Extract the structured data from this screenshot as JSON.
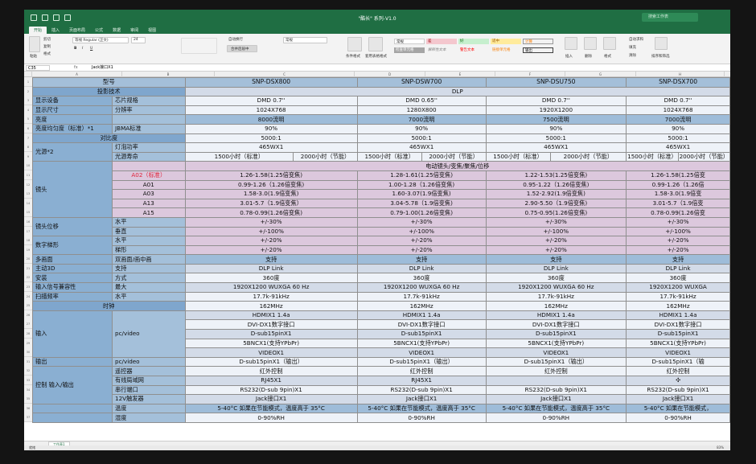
{
  "window": {
    "title": "\"酷长\" 系列-V1.0",
    "search_placeholder": "搜索工作表"
  },
  "ribbon_tabs": [
    "开始",
    "插入",
    "页面布局",
    "公式",
    "数据",
    "审阅",
    "视图"
  ],
  "ribbon": {
    "paste": "粘贴",
    "cut": "剪切",
    "copy": "复制",
    "format_painter": "格式",
    "font_name": "等线 Regular (正文)",
    "font_size": "24",
    "wrap_text": "自动换行",
    "merge_center": "合并后居中",
    "number_format": "常规",
    "conditional_format": "条件格式",
    "format_as_table": "套用表格格式",
    "styles": {
      "normal": "常规",
      "bad": "差",
      "good": "好",
      "neutral": "适中",
      "calculation": "计算",
      "check_cell": "检查单元格",
      "explanatory": "解释性文本",
      "warning": "警告文本",
      "linked": "链接单元格",
      "output": "输出"
    },
    "insert": "插入",
    "delete": "删除",
    "format": "格式",
    "autosum": "自动求和",
    "fill": "填充",
    "clear": "清除",
    "sort_filter": "排序和筛选"
  },
  "formula_bar": {
    "name_box": "C35",
    "fx": "fx",
    "value": "Jack接口X1"
  },
  "columns": [
    "A",
    "B",
    "C",
    "D",
    "E",
    "F",
    "G",
    "H",
    "I"
  ],
  "sheet_tab": "工作表1",
  "status": {
    "ready": "就绪",
    "zoom": "83%"
  },
  "table": {
    "header": {
      "label": "型号",
      "models": [
        "SNP-DSX800",
        "SNP-DSW700",
        "SNP-DSU750",
        "SNP-DSX700"
      ]
    },
    "projection_tech": {
      "label": "投影技术",
      "value": "DLP"
    },
    "rows_a": [
      {
        "a": "显示设备",
        "b": "芯片规格",
        "v": [
          "DMD 0.7''",
          "DMD 0.65''",
          "DMD 0.7''",
          "DMD 0.7''"
        ]
      },
      {
        "a": "显示尺寸",
        "b": "分辨率",
        "v": [
          "1024X768",
          "1280X800",
          "1920X1200",
          "1024X768"
        ]
      },
      {
        "a": "亮度",
        "b": "",
        "v": [
          "8000流明",
          "7000流明",
          "7500流明",
          "7000流明"
        ]
      },
      {
        "a": "亮度均匀度（标准）*1",
        "b": "JBMA标准",
        "v": [
          "90%",
          "90%",
          "90%",
          "90%"
        ]
      }
    ],
    "contrast": {
      "label": "对比度",
      "v": [
        "5000:1",
        "5000:1",
        "5000:1",
        "5000:1"
      ]
    },
    "light": {
      "label": "光源*2",
      "lamp_power": "灯泡功率",
      "lamp_life": "光源寿命",
      "power": [
        "465WX1",
        "465WX1",
        "465WX1",
        "465WX1"
      ],
      "life": [
        [
          "1500小时（标准）",
          "2000小时（节能）"
        ],
        [
          "1500小时（标准）",
          "2000小时（节能）"
        ],
        [
          "1500小时（标准）",
          "2000小时（节能）"
        ],
        [
          "1500小时（标准）",
          "2000小时（节能）"
        ]
      ]
    },
    "lens": {
      "label": "镜头",
      "merged": "电动镜头/变焦/聚焦/位移",
      "items": [
        {
          "name": "A02（标准）",
          "v": [
            "1.26-1.58(1.25倍变焦)",
            "1.28-1.61(1.25倍变焦)",
            "1.22-1.53(1.25倍变焦)",
            "1.26-1.58(1.25倍变"
          ]
        },
        {
          "name": "A01",
          "v": [
            "0.99-1.26（1.26倍变焦)",
            "1.00-1.28（1.26倍变焦)",
            "0.95-1.22（1.26倍变焦)",
            "0.99-1.26（1.26倍"
          ]
        },
        {
          "name": "A03",
          "v": [
            "1.58-3.0(1.9倍变焦)",
            "1.60-3.07(1.9倍变焦)",
            "1.52-2.92(1.9倍变焦)",
            "1.58-3.0(1.9倍变"
          ]
        },
        {
          "name": "A13",
          "v": [
            "3.01-5.7（1.9倍变焦）",
            "3.04-5.78（1.9倍变焦)",
            "2.90-5.50（1.9倍变焦)",
            "3.01-5.7（1.9倍变"
          ]
        },
        {
          "name": "A15",
          "v": [
            "0.78-0.99(1.26倍变焦)",
            "0.79-1.00(1.26倍变焦)",
            "0.75-0.95(1.26倍变焦)",
            "0.78-0.99(1.26倍变"
          ]
        }
      ]
    },
    "lens_shift": {
      "label": "镜头位移",
      "h": "水平",
      "v": "垂直",
      "hv": [
        "+/-30%",
        "+/-30%",
        "+/-30%",
        "+/-30%"
      ],
      "vv": [
        "+/-100%",
        "+/-100%",
        "+/-100%",
        "+/-100%"
      ]
    },
    "keystone": {
      "label": "数字梯形",
      "h": "水平",
      "v": "梯形",
      "hv": [
        "+/-20%",
        "+/-20%",
        "+/-20%",
        "+/-20%"
      ],
      "vv": [
        "+/-20%",
        "+/-20%",
        "+/-20%",
        "+/-20%"
      ]
    },
    "rows_b": [
      {
        "a": "多画面",
        "b": "双画面/画中画",
        "v": [
          "支持",
          "支持",
          "支持",
          "支持"
        ],
        "c": "bl"
      },
      {
        "a": "主动3D",
        "b": "支持",
        "v": [
          "DLP Link",
          "DLP Link",
          "DLP Link",
          "DLP Link"
        ],
        "c": "gr"
      },
      {
        "a": "安装",
        "b": "方式",
        "v": [
          "360度",
          "360度",
          "360度",
          "360度"
        ],
        "c": "wh"
      },
      {
        "a": "输入信号兼容性",
        "b": "最大",
        "v": [
          "1920X1200 WUXGA 60 Hz",
          "1920X1200 WUXGA 60 Hz",
          "1920X1200 WUXGA 60 Hz",
          "1920X1200 WUXGA"
        ],
        "c": "gr"
      },
      {
        "a": "扫描频率",
        "b": "水平",
        "v": [
          "17.7k-91kHz",
          "17.7k-91kHz",
          "17.7k-91kHz",
          "17.7k-91kHz"
        ],
        "c": "wh"
      }
    ],
    "clock": {
      "label": "时钟",
      "v": [
        "162MHz",
        "162MHz",
        "162MHz",
        "162MHz"
      ]
    },
    "input": {
      "label": "输入",
      "sub": "pc/video",
      "items": [
        [
          "HDMIX1  1.4a",
          "HDMIX1  1.4a",
          "HDMIX1  1.4a",
          "HDMIX1  1.4a"
        ],
        [
          "DVI-DX1数字接口",
          "DVI-DX1数字接口",
          "DVI-DX1数字接口",
          "DVI-DX1数字接口"
        ],
        [
          "D-sub15pinX1",
          "D-sub15pinX1",
          "D-sub15pinX1",
          "D-sub15pinX1"
        ],
        [
          "5BNCX1(支持YPbPr)",
          "5BNCX1(支持YPbPr)",
          "5BNCX1(支持YPbPr)",
          "5BNCX1(支持YPbPr)"
        ],
        [
          "VIDEOX1",
          "VIDEOX1",
          "VIDEOX1",
          "VIDEOX1"
        ]
      ]
    },
    "output": {
      "label": "输出",
      "sub": "pc/video",
      "v": [
        "D-sub15pinX1（输出）",
        "D-sub15pinX1（输出）",
        "D-sub15pinX1（输出）",
        "D-sub15pinX1（输"
      ]
    },
    "control": {
      "label": "控制 输入/输出",
      "items": [
        {
          "b": "遥控器",
          "v": [
            "红外控制",
            "红外控制",
            "红外控制",
            "红外控制"
          ]
        },
        {
          "b": "有线局域网",
          "v": [
            "RJ45X1",
            "RJ45X1",
            "",
            "✣"
          ]
        },
        {
          "b": "串行端口",
          "v": [
            "RS232(D-sub 9pin)X1",
            "RS232(D-sub 9pin)X1",
            "RS232(D-sub 9pin)X1",
            "RS232(D-sub 9pin)X1"
          ]
        },
        {
          "b": "12V触发器",
          "v": [
            "Jack接口X1",
            "Jack接口X1",
            "Jack接口X1",
            "Jack接口X1"
          ]
        }
      ]
    },
    "env": [
      {
        "b": "温度",
        "v": [
          "5-40°C 如果在节能模式，温度高于 35°C",
          "5-40°C 如果在节能模式，温度高于 35°C",
          "5-40°C 如果在节能模式，温度高于 35°C",
          "5-40°C 如果在节能模式，"
        ]
      },
      {
        "b": "湿度",
        "v": [
          "0-90%RH",
          "0-90%RH",
          "0-90%RH",
          "0-90%RH"
        ]
      }
    ]
  }
}
